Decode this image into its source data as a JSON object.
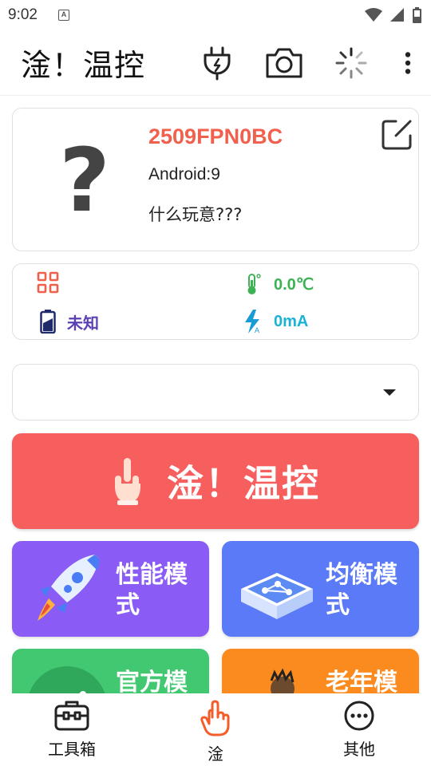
{
  "status_bar": {
    "time": "9:02",
    "notification_icon": "A"
  },
  "app_bar": {
    "title": "淦！温控",
    "actions": [
      "plug-icon",
      "camera-icon",
      "loading-icon",
      "more-vert-icon"
    ]
  },
  "device": {
    "avatar": "?",
    "model": "2509FPN0BC",
    "android": "Android:9",
    "description": "什么玩意???",
    "model_color": "#f0604d"
  },
  "stats": {
    "temperature": "0.0℃",
    "battery_status": "未知",
    "current": "0mA",
    "colors": {
      "temperature": "#3db254",
      "battery": "#5b3fb5",
      "current": "#1ab3d6",
      "grid": "#f0604d"
    }
  },
  "mode_select": {
    "value": ""
  },
  "main_button": {
    "label": "淦！温控",
    "color": "#f75f5f"
  },
  "modes": [
    {
      "label": "性能模式",
      "color": "#8a5cf5"
    },
    {
      "label": "均衡模式",
      "color": "#5b7af7"
    },
    {
      "label": "官方模式",
      "color": "#43c872"
    },
    {
      "label": "老年模式",
      "color": "#fb8b1e"
    }
  ],
  "bottom_nav": [
    {
      "label": "工具箱",
      "icon": "toolbox-icon"
    },
    {
      "label": "淦",
      "icon": "hand-pointer-icon",
      "active": true
    },
    {
      "label": "其他",
      "icon": "more-circle-icon"
    }
  ]
}
